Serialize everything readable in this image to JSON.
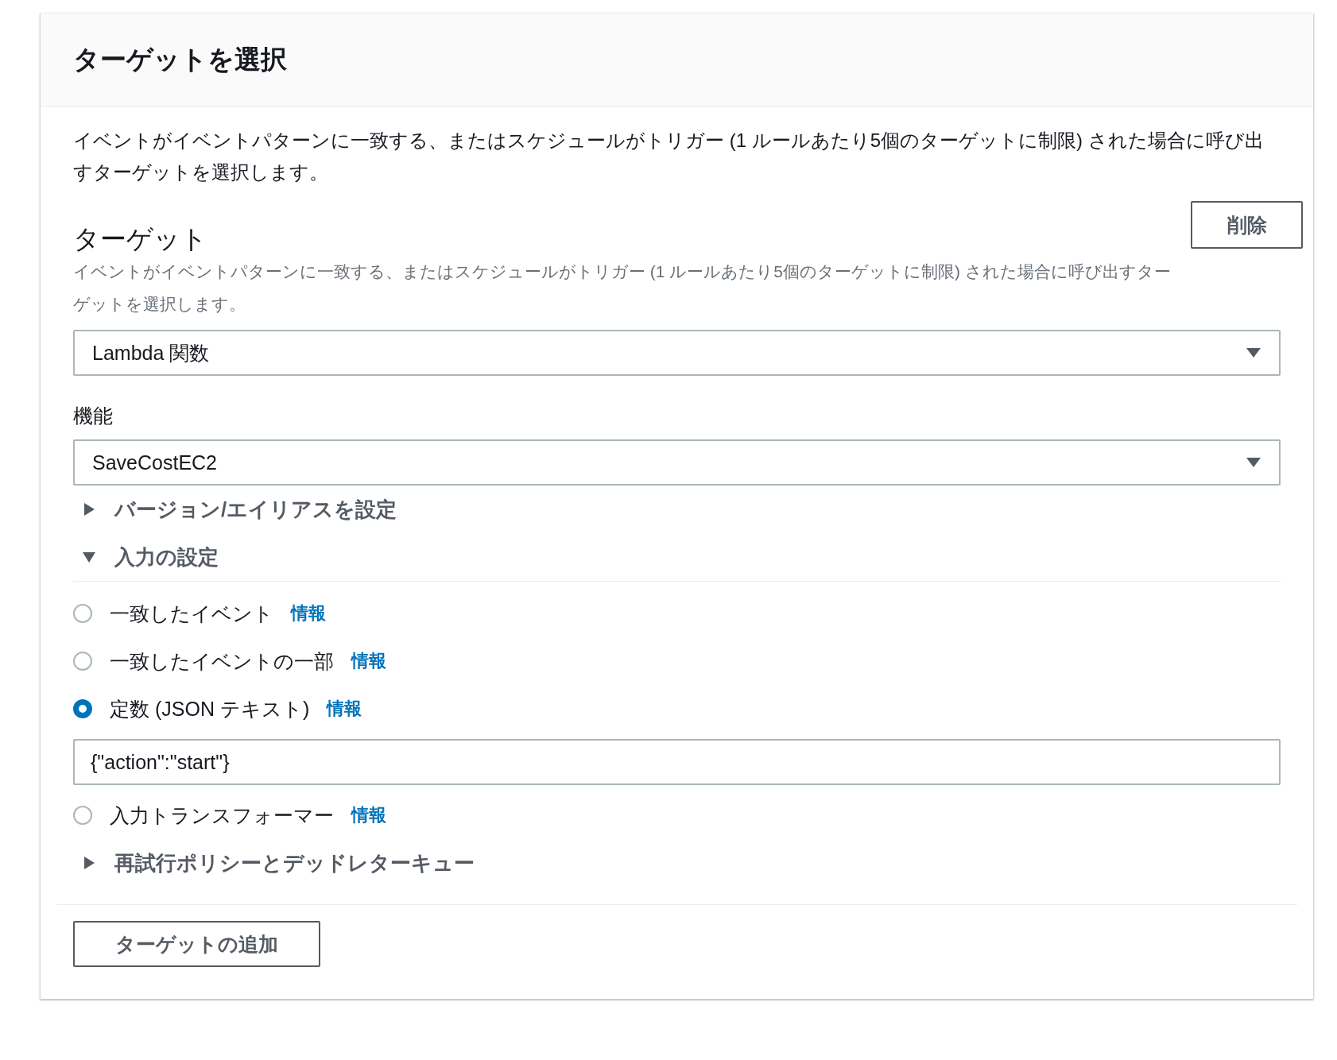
{
  "panel": {
    "title": "ターゲットを選択",
    "description": "イベントがイベントパターンに一致する、またはスケジュールがトリガー (1 ルールあたり5個のターゲットに制限) された場合に呼び出すターゲットを選択します。"
  },
  "target": {
    "label": "ターゲット",
    "description": "イベントがイベントパターンに一致する、またはスケジュールがトリガー (1 ルールあたり5個のターゲットに制限) された場合に呼び出すターゲットを選択します。",
    "remove_button": "削除",
    "type_select": {
      "value": "Lambda 関数"
    },
    "function": {
      "label": "機能",
      "value": "SaveCostEC2"
    }
  },
  "sections": [
    {
      "label": "バージョン/エイリアスを設定",
      "expanded": false
    },
    {
      "label": "入力の設定",
      "expanded": true,
      "options": [
        {
          "label": "一致したイベント",
          "info": "情報",
          "selected": false
        },
        {
          "label": "一致したイベントの一部",
          "info": "情報",
          "selected": false
        },
        {
          "label": "定数 (JSON テキスト)",
          "info": "情報",
          "selected": true,
          "value": "{\"action\":\"start\"}"
        },
        {
          "label": "入力トランスフォーマー",
          "info": "情報",
          "selected": false
        }
      ]
    },
    {
      "label": "再試行ポリシーとデッドレターキュー",
      "expanded": false
    }
  ],
  "add_button": "ターゲットの追加"
}
